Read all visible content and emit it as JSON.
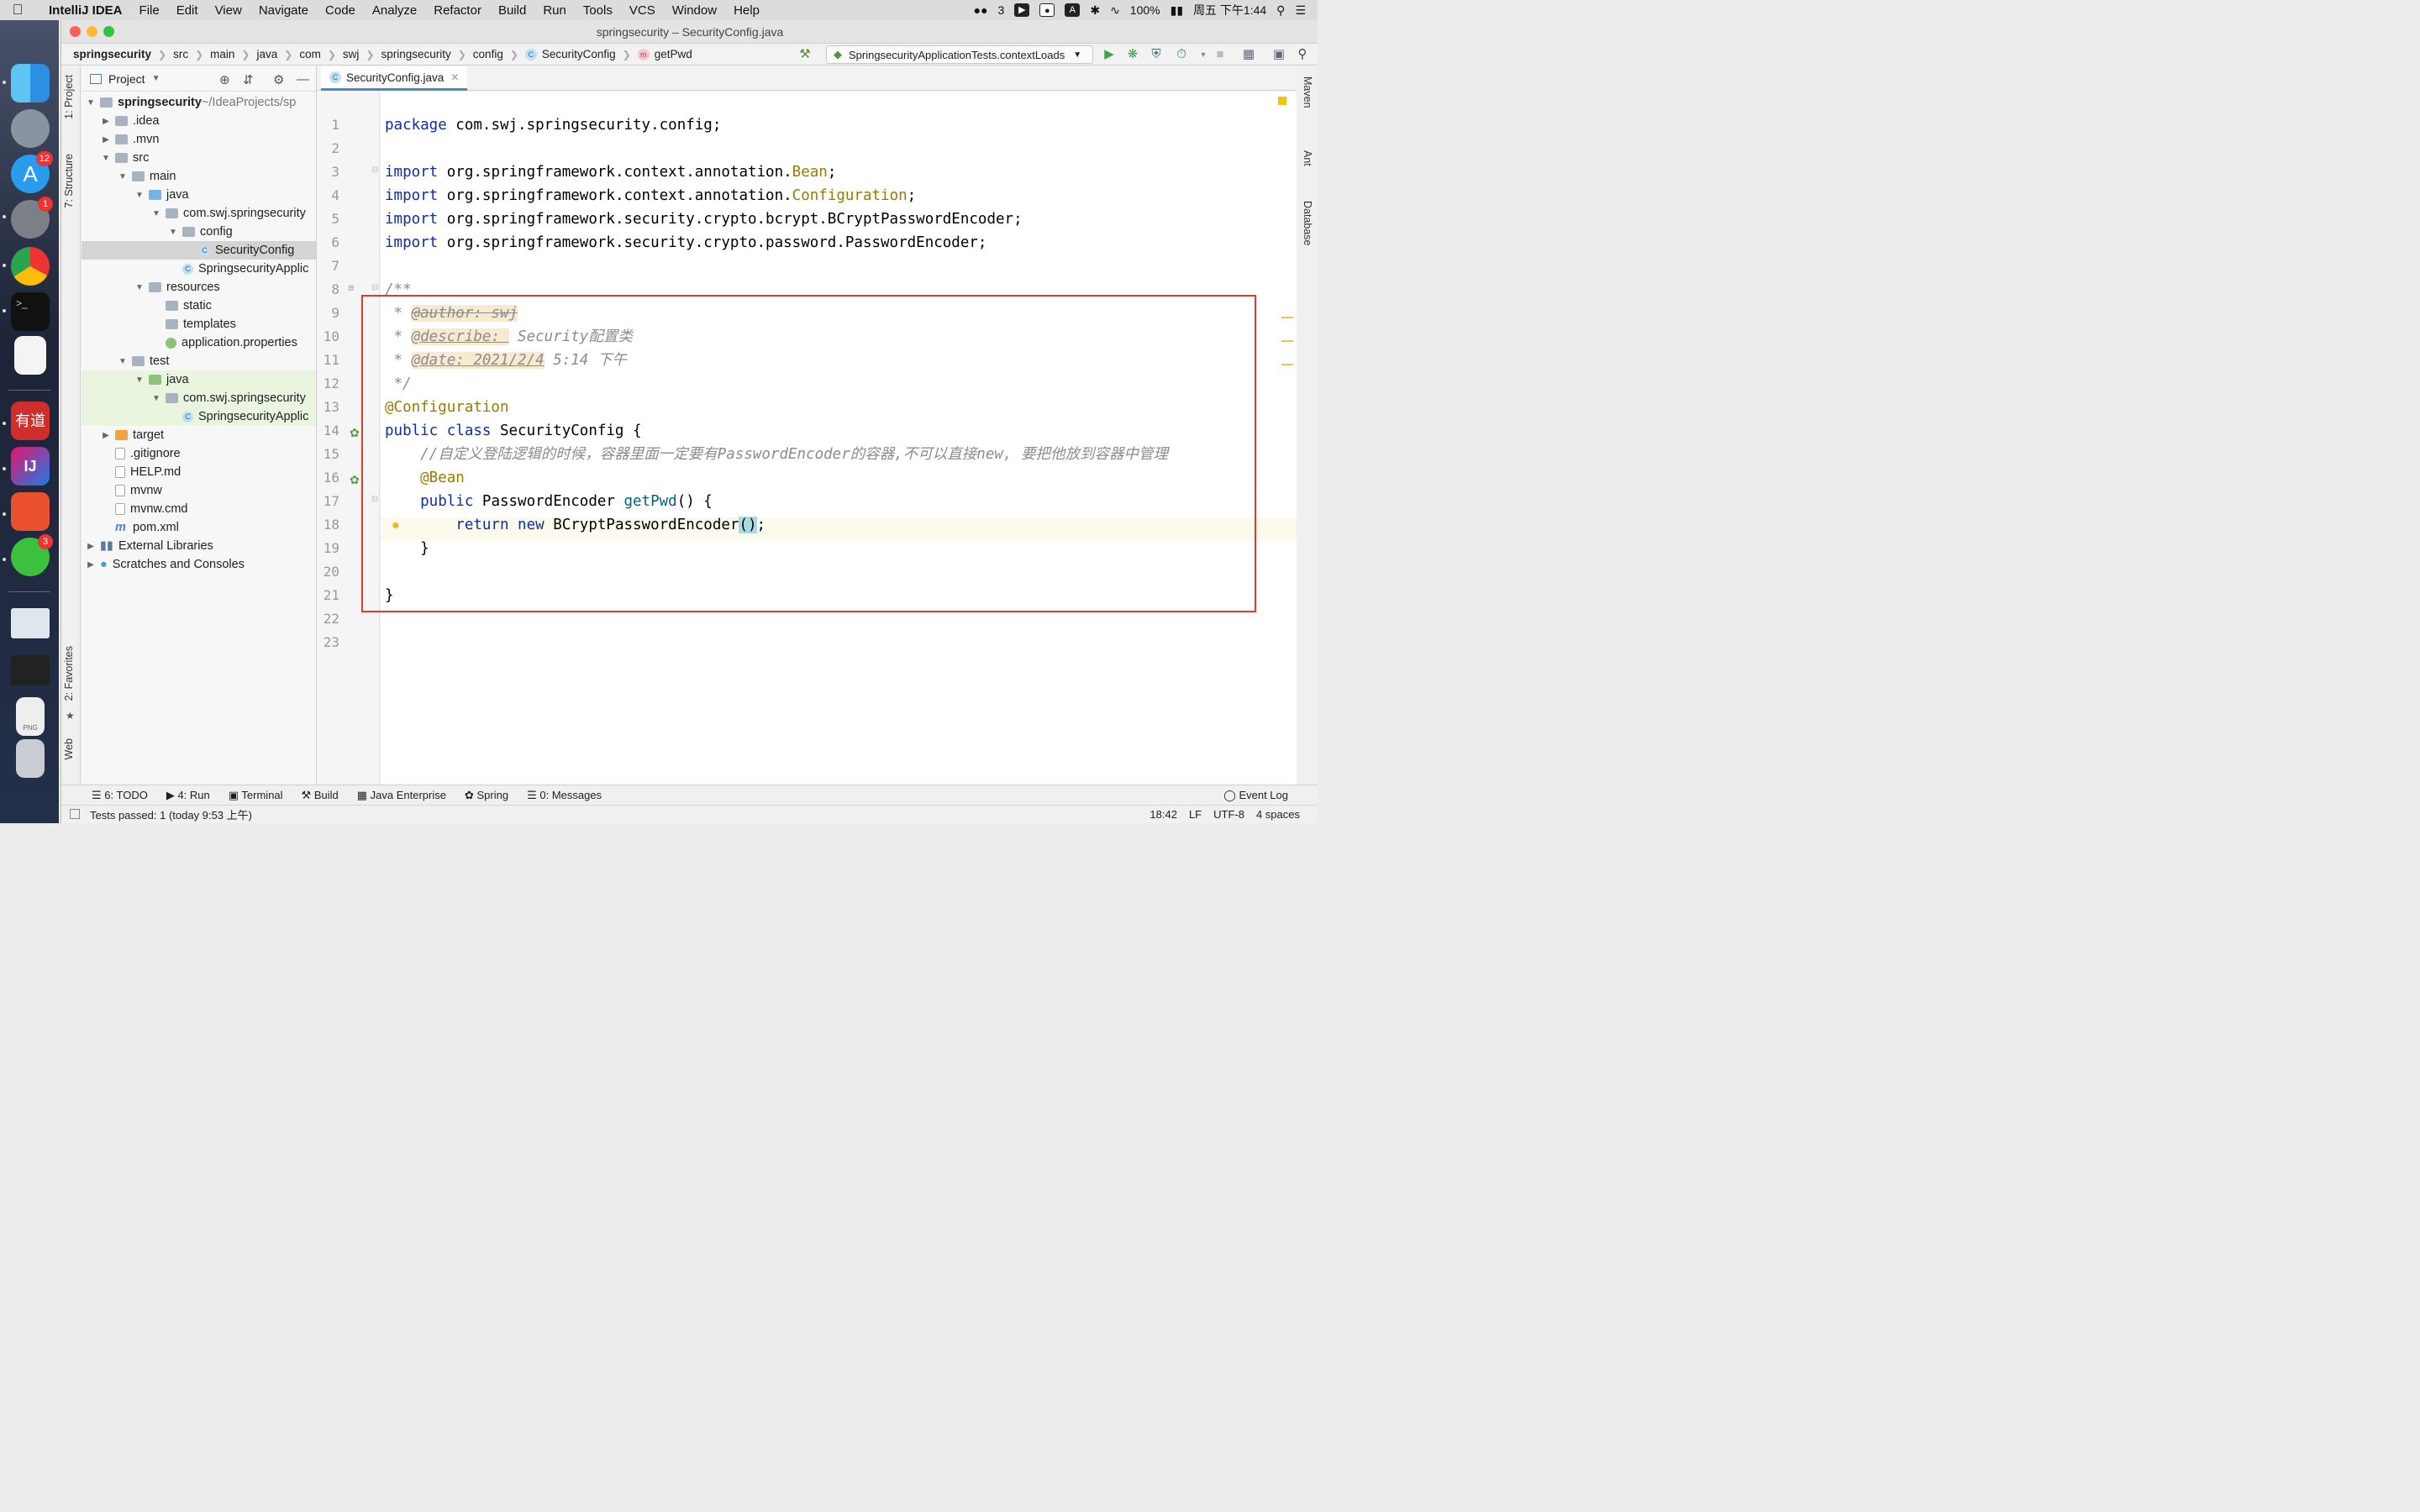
{
  "menubar": {
    "app": "IntelliJ IDEA",
    "items": [
      "File",
      "Edit",
      "View",
      "Navigate",
      "Code",
      "Analyze",
      "Refactor",
      "Build",
      "Run",
      "Tools",
      "VCS",
      "Window",
      "Help"
    ],
    "wechat_count": "3",
    "battery": "100%",
    "clock": "周五 下午1:44"
  },
  "dock": {
    "app_store_badge": "12",
    "settings_badge": "1",
    "wechat_badge": "3",
    "youdao_label": "有道",
    "png_label": "PNG"
  },
  "window": {
    "title": "springsecurity – SecurityConfig.java"
  },
  "breadcrumb": [
    "springsecurity",
    "src",
    "main",
    "java",
    "com",
    "swj",
    "springsecurity",
    "config",
    "SecurityConfig",
    "getPwd"
  ],
  "run_config": "SpringsecurityApplicationTests.contextLoads",
  "side_tools": {
    "project": "1: Project",
    "structure": "7: Structure",
    "favorites": "2: Favorites",
    "web": "Web",
    "maven": "Maven",
    "ant": "Ant",
    "database": "Database"
  },
  "project": {
    "header": "Project",
    "tree": [
      {
        "label": "springsecurity",
        "suffix": " ~/IdeaProjects/sp"
      },
      {
        "label": ".idea"
      },
      {
        "label": ".mvn"
      },
      {
        "label": "src"
      },
      {
        "label": "main"
      },
      {
        "label": "java"
      },
      {
        "label": "com.swj.springsecurity"
      },
      {
        "label": "config"
      },
      {
        "label": "SecurityConfig"
      },
      {
        "label": "SpringsecurityApplic"
      },
      {
        "label": "resources"
      },
      {
        "label": "static"
      },
      {
        "label": "templates"
      },
      {
        "label": "application.properties"
      },
      {
        "label": "test"
      },
      {
        "label": "java"
      },
      {
        "label": "com.swj.springsecurity"
      },
      {
        "label": "SpringsecurityApplic"
      },
      {
        "label": "target"
      },
      {
        "label": ".gitignore"
      },
      {
        "label": "HELP.md"
      },
      {
        "label": "mvnw"
      },
      {
        "label": "mvnw.cmd"
      },
      {
        "label": "pom.xml"
      },
      {
        "label": "External Libraries"
      },
      {
        "label": "Scratches and Consoles"
      }
    ]
  },
  "editor": {
    "tab": "SecurityConfig.java",
    "lines": [
      "1",
      "2",
      "3",
      "4",
      "5",
      "6",
      "7",
      "8",
      "9",
      "10",
      "11",
      "12",
      "13",
      "14",
      "15",
      "16",
      "17",
      "18",
      "19",
      "20",
      "21",
      "22",
      "23"
    ],
    "code": {
      "l1a": "package ",
      "l1b": "com.swj.springsecurity.config;",
      "l3a": "import ",
      "l3b": "org.springframework.context.annotation.",
      "l3c": "Bean",
      ";": ";",
      "l4a": "import ",
      "l4b": "org.springframework.context.annotation.",
      "l4c": "Configuration",
      "l5a": "import ",
      "l5b": "org.springframework.security.crypto.bcrypt.BCryptPasswordEncoder;",
      "l6a": "import ",
      "l6b": "org.springframework.security.crypto.password.PasswordEncoder;",
      "l8": "/**",
      "l9a": " * ",
      "l9b": "@author: swj",
      "l10a": " * ",
      "l10b": "@describe: ",
      "l10c": " Security配置类",
      "l11a": " * ",
      "l11b": "@date: 2021/2/4",
      "l11c": " 5:14 下午",
      "l12": " */",
      "l13": "@Configuration",
      "l14a": "public class ",
      "l14b": "SecurityConfig {",
      "l15": "    //自定义登陆逻辑的时候，容器里面一定要有PasswordEncoder的容器,不可以直接new, 要把他放到容器中管理",
      "l16": "    @Bean",
      "l17a": "    public ",
      "l17b": "PasswordEncoder ",
      "l17c": "getPwd",
      "l17d": "() {",
      "l18a": "        return new ",
      "l18b": "BCryptPasswordEncoder",
      "l18c": "()",
      "l19": "    }",
      "l21": "}"
    }
  },
  "bottom_tools": [
    "6: TODO",
    "4: Run",
    "Terminal",
    "Build",
    "Java Enterprise",
    "Spring",
    "0: Messages"
  ],
  "event_log": "Event Log",
  "status": {
    "message": "Tests passed: 1 (today 9:53 上午)",
    "position": "18:42",
    "line_sep": "LF",
    "encoding": "UTF-8",
    "indent": "4 spaces"
  }
}
